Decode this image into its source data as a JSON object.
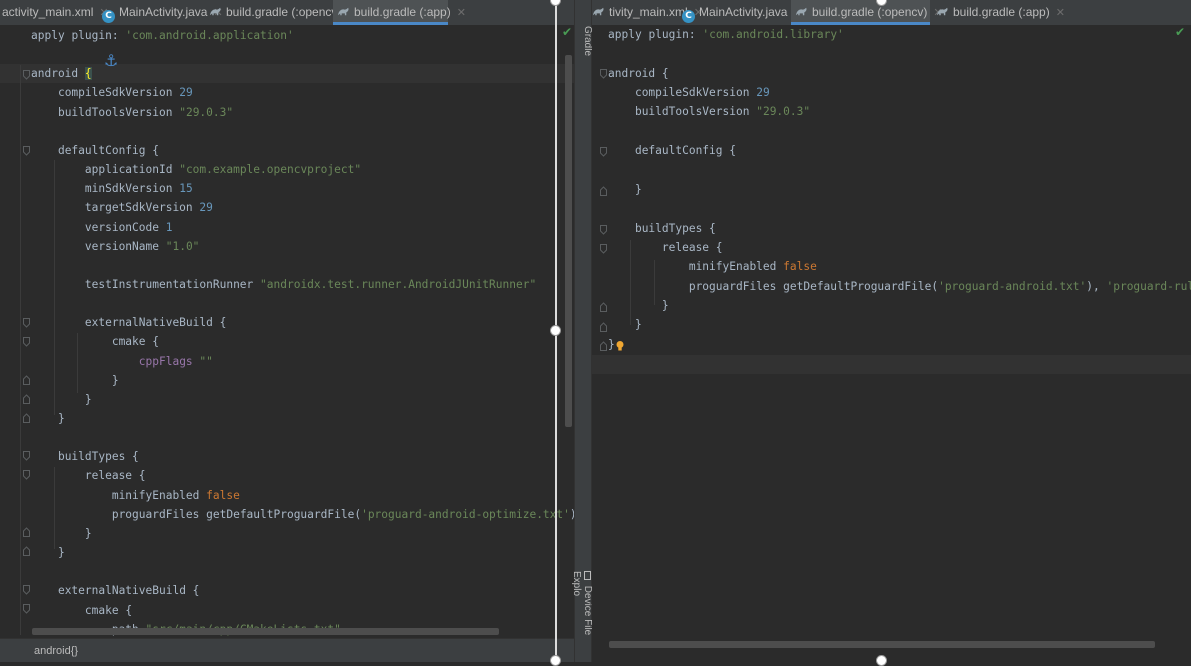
{
  "left": {
    "tabs": [
      {
        "label": "activity_main.xml",
        "icon": "xml-file-icon",
        "active": false
      },
      {
        "label": "MainActivity.java",
        "icon": "java-class-icon",
        "active": false
      },
      {
        "label": "build.gradle (:opencv)",
        "icon": "gradle-icon",
        "active": false
      },
      {
        "label": "build.gradle (:app)",
        "icon": "gradle-icon",
        "active": true
      }
    ],
    "code": [
      "apply plugin: 'com.android.application'",
      "",
      "android {",
      "    compileSdkVersion 29",
      "    buildToolsVersion \"29.0.3\"",
      "",
      "    defaultConfig {",
      "        applicationId \"com.example.opencvproject\"",
      "        minSdkVersion 15",
      "        targetSdkVersion 29",
      "        versionCode 1",
      "        versionName \"1.0\"",
      "",
      "        testInstrumentationRunner \"androidx.test.runner.AndroidJUnitRunner\"",
      "",
      "        externalNativeBuild {",
      "            cmake {",
      "                cppFlags \"\"",
      "            }",
      "        }",
      "    }",
      "",
      "    buildTypes {",
      "        release {",
      "            minifyEnabled false",
      "            proguardFiles getDefaultProguardFile('proguard-android-optimize.txt'), 'proguard-rul",
      "        }",
      "    }",
      "",
      "    externalNativeBuild {",
      "        cmake {",
      "            path \"src/main/cpp/CMakeLists.txt\""
    ],
    "status_breadcrumb": "android{}"
  },
  "right": {
    "tabs": [
      {
        "label": "tivity_main.xml",
        "icon": "xml-file-icon",
        "active": false
      },
      {
        "label": "MainActivity.java",
        "icon": "java-class-icon",
        "active": false
      },
      {
        "label": "build.gradle (:opencv)",
        "icon": "gradle-icon",
        "active": true
      },
      {
        "label": "build.gradle (:app)",
        "icon": "gradle-icon",
        "active": false
      }
    ],
    "code": [
      "apply plugin: 'com.android.library'",
      "",
      "android {",
      "    compileSdkVersion 29",
      "    buildToolsVersion \"29.0.3\"",
      "",
      "    defaultConfig {",
      "",
      "    }",
      "",
      "    buildTypes {",
      "        release {",
      "            minifyEnabled false",
      "            proguardFiles getDefaultProguardFile('proguard-android.txt'), 'proguard-rules.txt'",
      "        }",
      "    }",
      "}"
    ]
  },
  "side_panel": {
    "tabs": [
      "Gradle",
      "Device File Explo"
    ]
  },
  "colors": {
    "background": "#2b2b2b",
    "keyword": "#cc7832",
    "string": "#6a8759",
    "number": "#6897bb",
    "property": "#9876aa",
    "active_tab_underline": "#4a88c7"
  }
}
